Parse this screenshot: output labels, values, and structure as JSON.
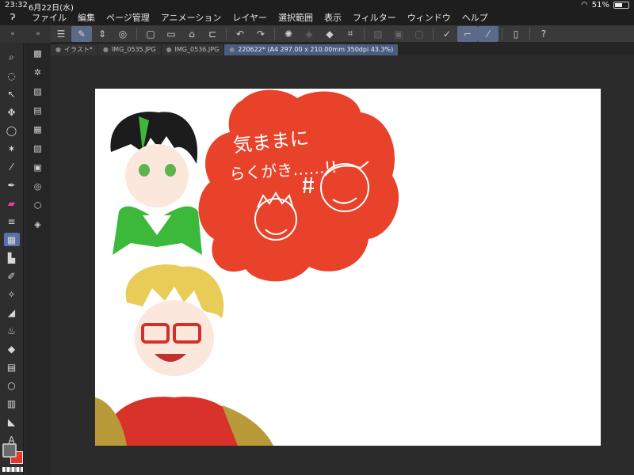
{
  "status": {
    "time": "23:32",
    "date": "6月22日(水)",
    "battery": "51%"
  },
  "menu": {
    "items": [
      "ファイル",
      "編集",
      "ページ管理",
      "アニメーション",
      "レイヤー",
      "選択範囲",
      "表示",
      "フィルター",
      "ウィンドウ",
      "ヘルプ"
    ]
  },
  "tabs": [
    {
      "label": "イラスト*"
    },
    {
      "label": "IMG_0535.JPG"
    },
    {
      "label": "IMG_0536.JPG"
    },
    {
      "label": "220622* (A4 297.00 x 210.00mm 350dpi 43.3%)"
    }
  ],
  "canvas": {
    "bubble_text_line1": "気ままに",
    "bubble_text_line2": "らくがき‥‥‥!!"
  },
  "colors": {
    "accent": "#5b6fa8",
    "bubble": "#e8432a",
    "main_color": "#6a6a6a",
    "sub_color": "#e8362a"
  }
}
